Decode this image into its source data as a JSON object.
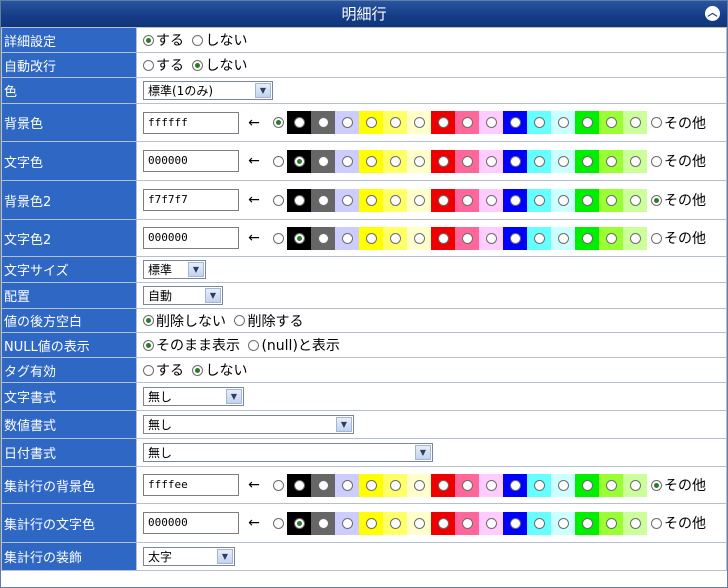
{
  "window": {
    "title": "明細行"
  },
  "colors": {
    "swatches": [
      {
        "hex": "#ffffff",
        "name": "white"
      },
      {
        "hex": "#000000",
        "name": "black"
      },
      {
        "hex": "#666666",
        "name": "gray"
      },
      {
        "hex": "#ccccff",
        "name": "lavender"
      },
      {
        "hex": "#ffff00",
        "name": "yellow"
      },
      {
        "hex": "#ffff66",
        "name": "light-yellow"
      },
      {
        "hex": "#ffffcc",
        "name": "cream"
      },
      {
        "hex": "#ee0000",
        "name": "red"
      },
      {
        "hex": "#ff6699",
        "name": "pink"
      },
      {
        "hex": "#ffccff",
        "name": "light-pink"
      },
      {
        "hex": "#0000ff",
        "name": "blue"
      },
      {
        "hex": "#66ffff",
        "name": "aqua"
      },
      {
        "hex": "#ccffff",
        "name": "light-aqua"
      },
      {
        "hex": "#00ee00",
        "name": "green"
      },
      {
        "hex": "#99ff33",
        "name": "lime"
      },
      {
        "hex": "#ccff99",
        "name": "light-lime"
      }
    ]
  },
  "rows": {
    "detail_setting": {
      "label": "詳細設定",
      "opt1": "する",
      "opt2": "しない"
    },
    "auto_wrap": {
      "label": "自動改行",
      "opt1": "する",
      "opt2": "しない"
    },
    "color": {
      "label": "色",
      "selected": "標準(1のみ)"
    },
    "bg_color": {
      "label": "背景色",
      "value": "ffffff"
    },
    "text_color": {
      "label": "文字色",
      "value": "000000"
    },
    "bg_color2": {
      "label": "背景色2",
      "value": "f7f7f7"
    },
    "text_color2": {
      "label": "文字色2",
      "value": "000000"
    },
    "font_size": {
      "label": "文字サイズ",
      "selected": "標準"
    },
    "align": {
      "label": "配置",
      "selected": "自動"
    },
    "trailing_space": {
      "label": "値の後方空白",
      "opt1": "削除しない",
      "opt2": "削除する"
    },
    "null_display": {
      "label": "NULL値の表示",
      "opt1": "そのまま表示",
      "opt2": "(null)と表示"
    },
    "tag_enabled": {
      "label": "タグ有効",
      "opt1": "する",
      "opt2": "しない"
    },
    "text_format": {
      "label": "文字書式",
      "selected": "無し"
    },
    "number_format": {
      "label": "数値書式",
      "selected": "無し"
    },
    "date_format": {
      "label": "日付書式",
      "selected": "無し"
    },
    "total_bg": {
      "label": "集計行の背景色",
      "value": "ffffee"
    },
    "total_text": {
      "label": "集計行の文字色",
      "value": "000000"
    },
    "total_deco": {
      "label": "集計行の装飾",
      "selected": "太字"
    }
  },
  "arrow": "←",
  "other_label": "その他"
}
